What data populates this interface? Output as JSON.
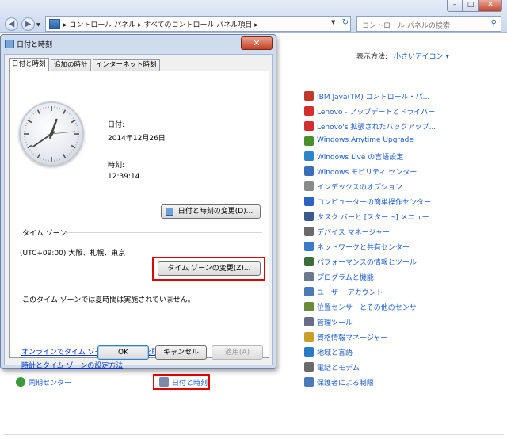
{
  "control_panel": {
    "window_buttons": {
      "minimize": "–",
      "maximize": "□",
      "close": "✕"
    },
    "breadcrumb": "▸ コントロール パネル ▸ すべてのコントロール パネル項目 ▸",
    "search_placeholder": "コントロール パネルの検索",
    "view_by_label": "表示方法:",
    "view_by_value": "小さいアイコン ▾",
    "right_items": [
      {
        "label": "IBM Java(TM) コントロール・パ...",
        "icon": "java-icon",
        "color": "#c0392b"
      },
      {
        "label": "Lenovo - アップデートとドライバー",
        "icon": "lenovo-update-icon",
        "color": "#d32f2f"
      },
      {
        "label": "Lenovo's 拡張されたバックアップ...",
        "icon": "lenovo-backup-icon",
        "color": "#d32f2f"
      },
      {
        "label": "Windows Anytime Upgrade",
        "icon": "windows-flag-icon",
        "color": "#4a8f2e"
      },
      {
        "label": "Windows Live の言語設定",
        "icon": "windows-live-icon",
        "color": "#2b86c8"
      },
      {
        "label": "Windows モビリティ センター",
        "icon": "mobility-center-icon",
        "color": "#3a6fb8"
      },
      {
        "label": "インデックスのオプション",
        "icon": "index-options-icon",
        "color": "#8a8a8a"
      },
      {
        "label": "コンピューターの簡単操作センター",
        "icon": "ease-of-access-icon",
        "color": "#2a63c2"
      },
      {
        "label": "タスク バーと [スタート] メニュー",
        "icon": "taskbar-icon",
        "color": "#3a5a8c"
      },
      {
        "label": "デバイス マネージャー",
        "icon": "device-manager-icon",
        "color": "#6a6a6a"
      },
      {
        "label": "ネットワークと共有センター",
        "icon": "network-icon",
        "color": "#3a7ac8"
      },
      {
        "label": "パフォーマンスの情報とツール",
        "icon": "performance-icon",
        "color": "#3c6e3c"
      },
      {
        "label": "プログラムと機能",
        "icon": "programs-icon",
        "color": "#6a7a8c"
      },
      {
        "label": "ユーザー アカウント",
        "icon": "user-accounts-icon",
        "color": "#4a7ab8"
      },
      {
        "label": "位置センサーとその他のセンサー",
        "icon": "sensors-icon",
        "color": "#6a8a3a"
      },
      {
        "label": "管理ツール",
        "icon": "admin-tools-icon",
        "color": "#6a6a8a"
      },
      {
        "label": "資格情報マネージャー",
        "icon": "credential-manager-icon",
        "color": "#c8a028"
      },
      {
        "label": "地域と言語",
        "icon": "region-language-icon",
        "color": "#2a7ac8"
      },
      {
        "label": "電話とモデム",
        "icon": "phone-modem-icon",
        "color": "#6a6a6a"
      },
      {
        "label": "保護者による制限",
        "icon": "parental-controls-icon",
        "color": "#4a7ab8"
      }
    ],
    "left_bottom_item": {
      "label": "同期センター",
      "icon": "sync-center-icon",
      "color": "#3a9a3a"
    },
    "mid_bottom_item": {
      "label": "日付と時刻",
      "icon": "date-time-icon",
      "color": "#7a8aa8"
    }
  },
  "dialog": {
    "title": "日付と時刻",
    "close_glyph": "✕",
    "tabs": [
      "日付と時刻",
      "追加の時計",
      "インターネット時刻"
    ],
    "clock_time": {
      "hour": 12,
      "minute": 39,
      "second": 14
    },
    "date_label": "日付:",
    "date_value": "2014年12月26日",
    "time_label": "時刻:",
    "time_value": "12:39:14",
    "change_datetime_button": "日付と時刻の変更(D)...",
    "timezone_heading": "タイム ゾーン",
    "timezone_value": "(UTC+09:00) 大阪、札幌、東京",
    "change_timezone_button": "タイム ゾーンの変更(Z)...",
    "dst_note": "このタイム ゾーンでは夏時間は実施されていません。",
    "link_timezone_info": "オンラインでタイム ゾーンの詳細情報を取得",
    "link_settings": "時計とタイム ゾーンの設定方法",
    "ok_button": "OK",
    "cancel_button": "キャンセル",
    "apply_button": "適用(A)"
  }
}
